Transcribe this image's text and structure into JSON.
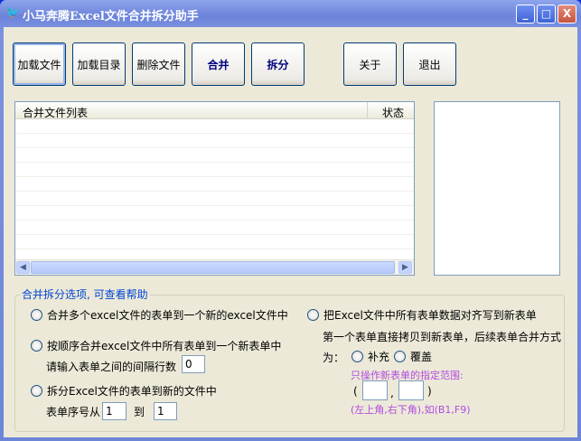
{
  "window": {
    "title": "小马奔腾Excel文件合并拆分助手",
    "minimize": "_",
    "maximize": "□",
    "close": "X"
  },
  "toolbar": {
    "load_file": "加载文件",
    "load_dir": "加载目录",
    "delete_file": "删除文件",
    "merge": "合并",
    "split": "拆分",
    "about": "关于",
    "exit": "退出"
  },
  "list": {
    "col_files": "合并文件列表",
    "col_status": "状态"
  },
  "options": {
    "group_label": "合并拆分选项, 可查看帮助",
    "opt1": "合并多个excel文件的表单到一个新的excel文件中",
    "opt2": "按顺序合并excel文件中所有表单到一个新表单中",
    "gap_label": "请输入表单之间的间隔行数",
    "gap_value": "0",
    "opt3": "拆分Excel文件的表单到新的文件中",
    "sheet_from_label": "表单序号从",
    "sheet_from": "1",
    "to_label": "到",
    "sheet_to": "1",
    "opt4": "把Excel文件中所有表单数据对齐写到新表单",
    "desc1": "第一个表单直接拷贝到新表单，后续表单合并方式",
    "desc2": "为：",
    "mode_append": "补充",
    "mode_overwrite": "覆盖",
    "range_label": "只操作新表单的指定范围:",
    "paren_open": "(",
    "comma": ",",
    "paren_close": ")",
    "range_from": "",
    "range_to": "",
    "range_hint": "(左上角,右下角),如(B1,F9)"
  }
}
